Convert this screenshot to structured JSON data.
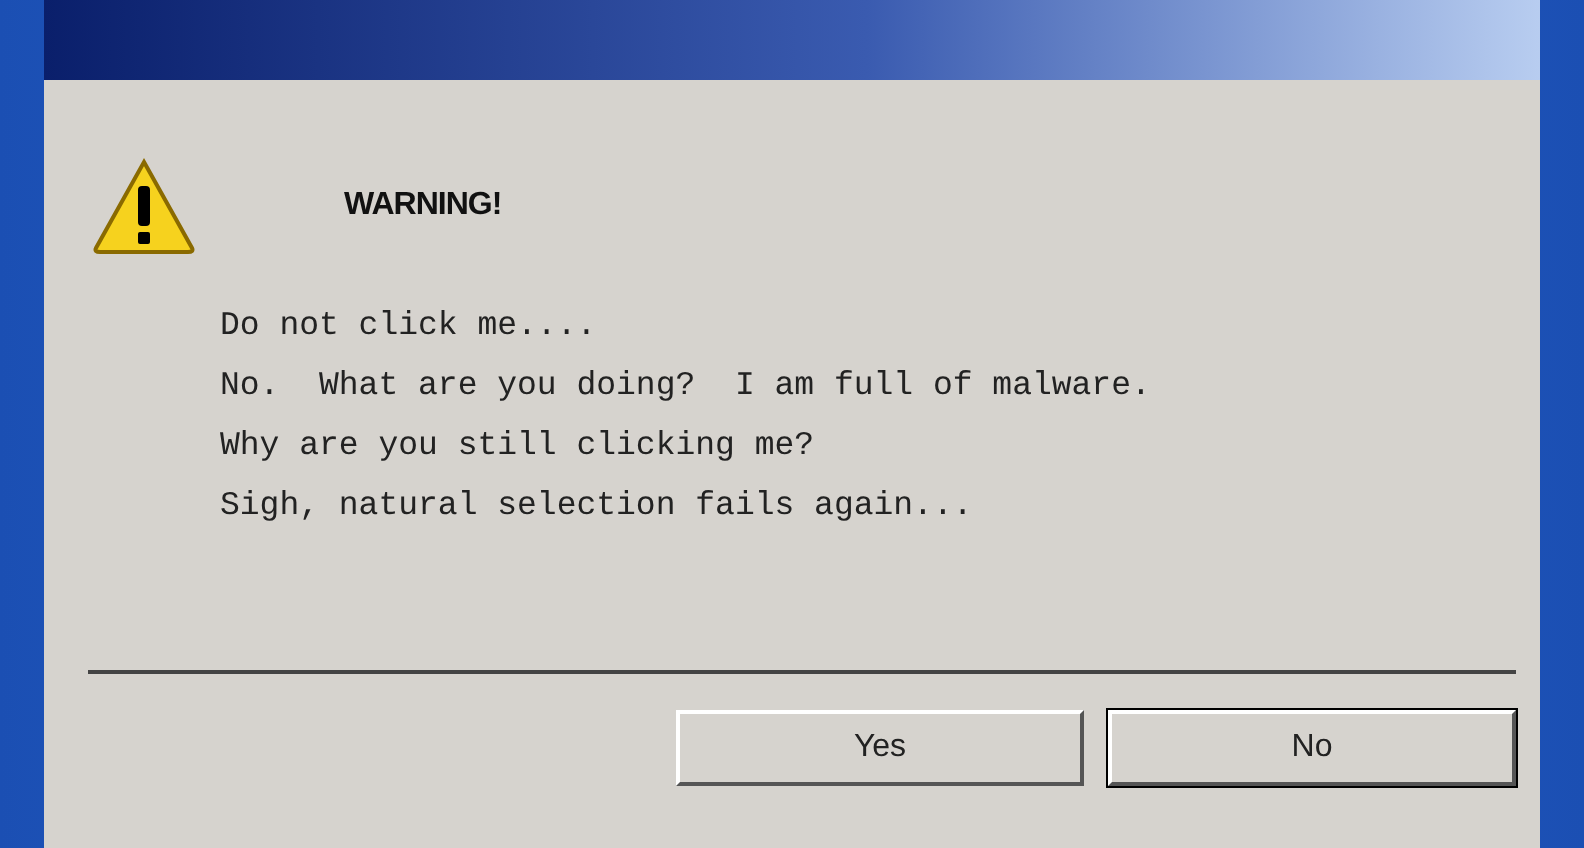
{
  "dialog": {
    "heading": "WARNING!",
    "message_lines": [
      "Do not click me....",
      "No.  What are you doing?  I am full of malware.",
      "Why are you still clicking me?",
      "Sigh, natural selection fails again..."
    ],
    "buttons": [
      {
        "label": "Yes",
        "default": false
      },
      {
        "label": "No",
        "default": true
      }
    ]
  }
}
